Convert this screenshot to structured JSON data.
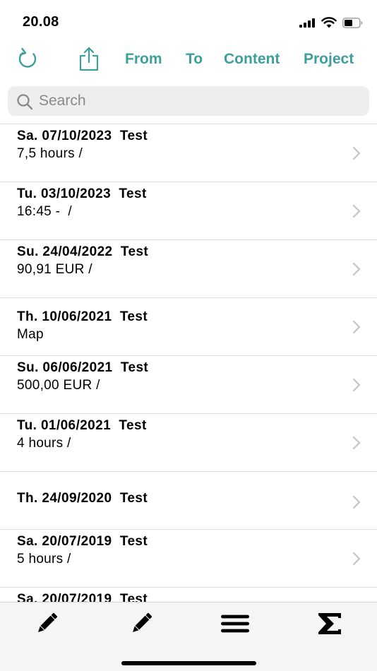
{
  "status_bar": {
    "time": "20.08",
    "icons": [
      "cellular-signal-icon",
      "wifi-icon",
      "battery-icon"
    ]
  },
  "toolbar": {
    "icons": [
      "refresh-icon",
      "share-icon"
    ],
    "from_label": "From",
    "to_label": "To",
    "content_label": "Content",
    "project_label": "Project"
  },
  "search": {
    "placeholder": "Search",
    "value": ""
  },
  "entries": [
    {
      "title": "Sa. 07/10/2023  Test",
      "subtitle": "7,5 hours /"
    },
    {
      "title": "Tu. 03/10/2023  Test",
      "subtitle": "16:45 -  /"
    },
    {
      "title": "Su. 24/04/2022  Test",
      "subtitle": "90,91 EUR /"
    },
    {
      "title": "Th. 10/06/2021  Test",
      "subtitle": "Map"
    },
    {
      "title": "Su. 06/06/2021  Test",
      "subtitle": "500,00 EUR /"
    },
    {
      "title": "Tu. 01/06/2021  Test",
      "subtitle": "4 hours /"
    },
    {
      "title": "Th. 24/09/2020  Test",
      "subtitle": ""
    },
    {
      "title": "Sa. 20/07/2019  Test",
      "subtitle": "5 hours /"
    },
    {
      "title": "Sa. 20/07/2019  Test",
      "subtitle": ""
    }
  ],
  "bottom_bar": {
    "icons": [
      "pencil-icon",
      "pencil-icon",
      "menu-icon",
      "sigma-icon"
    ]
  },
  "colors": {
    "accent": "#3d9e9a",
    "chevron": "#c4c4c7",
    "search_bg": "#eeeeef",
    "bottom_bar_bg": "#f5f5f5"
  }
}
